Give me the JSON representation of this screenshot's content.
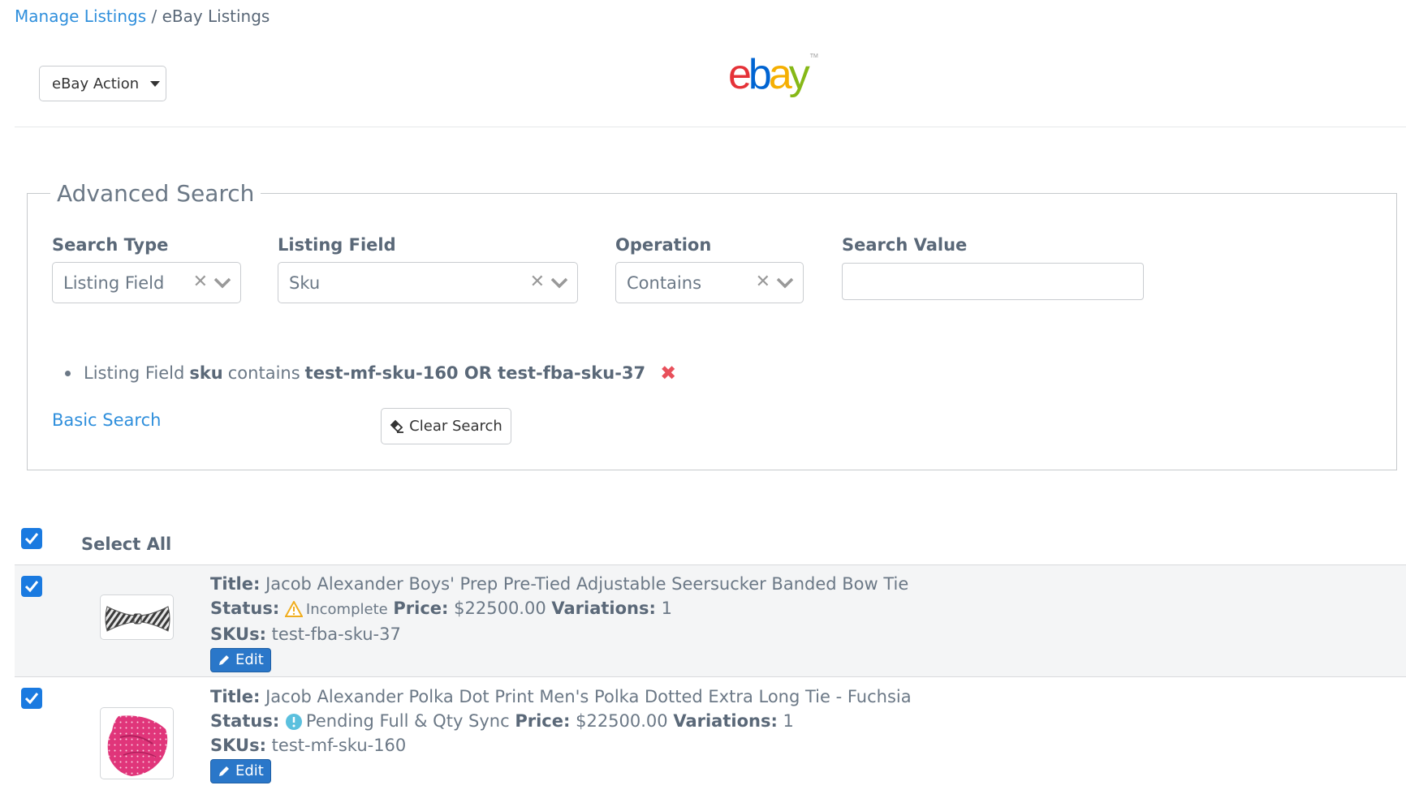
{
  "breadcrumb": {
    "parent": "Manage Listings",
    "separator": " / ",
    "current": "eBay Listings"
  },
  "toolbar": {
    "action_label": "eBay Action"
  },
  "logo": {
    "e": "e",
    "b": "b",
    "a": "a",
    "y": "y",
    "tm": "TM"
  },
  "advanced_search": {
    "legend": "Advanced Search",
    "fields": {
      "search_type": {
        "label": "Search Type",
        "value": "Listing Field"
      },
      "listing_field": {
        "label": "Listing Field",
        "value": "Sku"
      },
      "operation": {
        "label": "Operation",
        "value": "Contains"
      },
      "search_value": {
        "label": "Search Value",
        "value": ""
      }
    },
    "criterion": {
      "prefix": "Listing Field",
      "field": "sku",
      "op": "contains",
      "value": "test-mf-sku-160 OR test-fba-sku-37"
    },
    "basic_search_link": "Basic Search",
    "clear_search_label": "Clear Search"
  },
  "listings": {
    "select_all_label": "Select All",
    "labels": {
      "title": "Title:",
      "status": "Status:",
      "price": "Price:",
      "variations": "Variations:",
      "skus": "SKUs:",
      "edit": "Edit"
    },
    "items": [
      {
        "title": "Jacob Alexander Boys' Prep Pre-Tied Adjustable Seersucker Banded Bow Tie",
        "status": "Incomplete",
        "status_icon": "warning-icon",
        "price": "$22500.00",
        "variations": "1",
        "skus": "test-fba-sku-37",
        "checked": true
      },
      {
        "title": "Jacob Alexander Polka Dot Print Men's Polka Dotted Extra Long Tie - Fuchsia",
        "status": "Pending Full & Qty Sync",
        "status_icon": "info-icon",
        "price": "$22500.00",
        "variations": "1",
        "skus": "test-mf-sku-160",
        "checked": true
      }
    ]
  },
  "colors": {
    "link": "#2f8fdc",
    "primary": "#1a7ae0",
    "danger": "#e8505b",
    "warning": "#f0ad1e",
    "info": "#5bc0de"
  }
}
